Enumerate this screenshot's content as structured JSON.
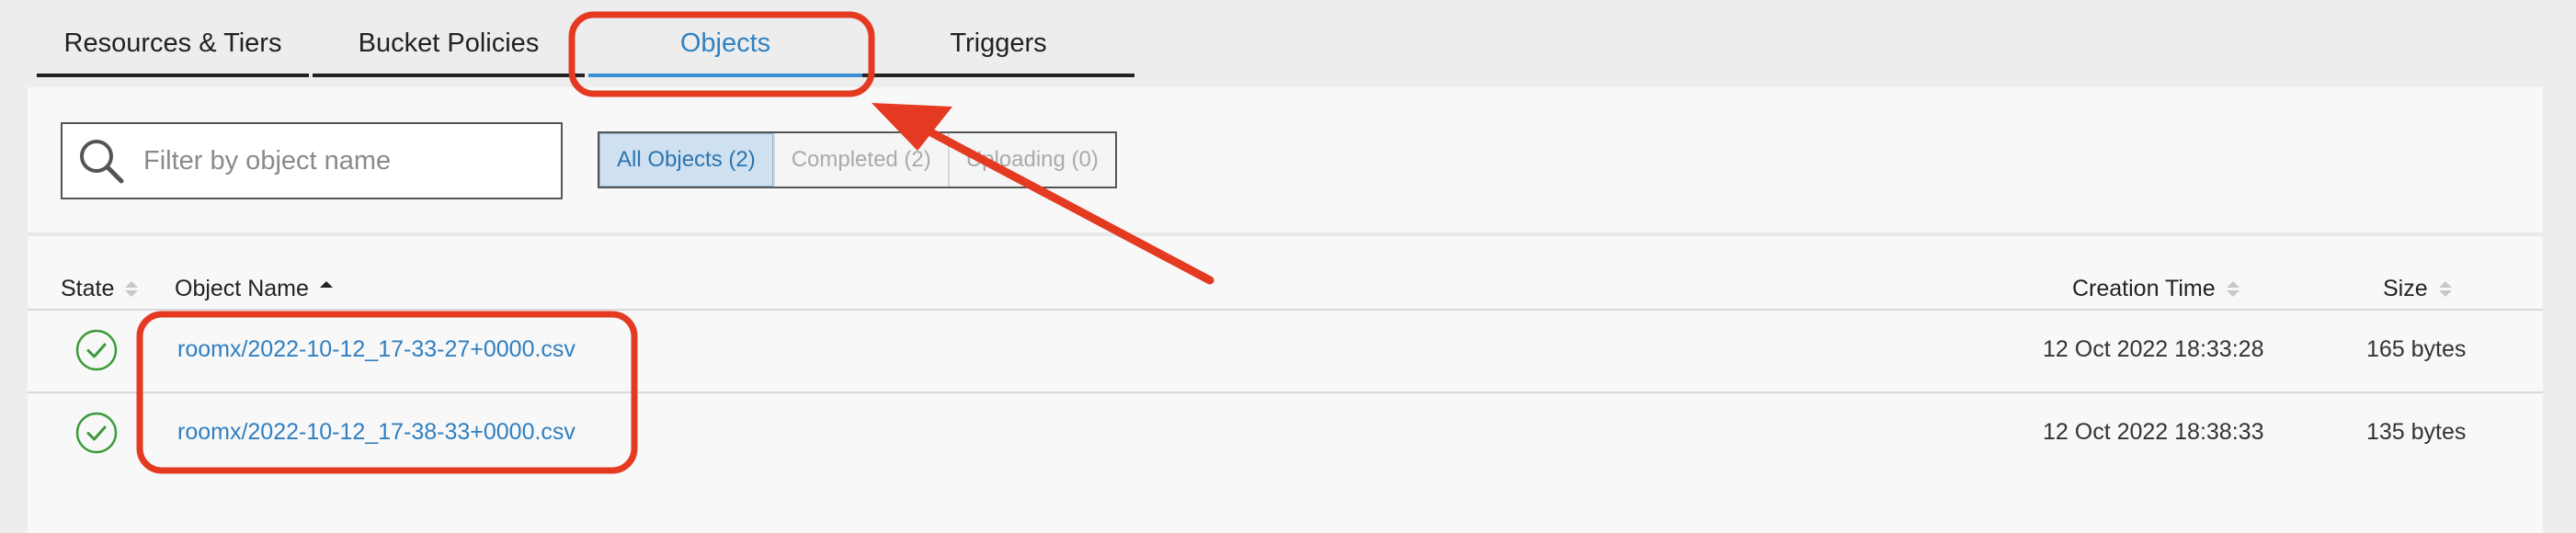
{
  "tabs": [
    {
      "label": "Resources & Tiers",
      "active": false
    },
    {
      "label": "Bucket Policies",
      "active": false
    },
    {
      "label": "Objects",
      "active": true
    },
    {
      "label": "Triggers",
      "active": false
    }
  ],
  "search": {
    "placeholder": "Filter by object name",
    "value": "",
    "icon": "search-icon"
  },
  "filters": [
    {
      "label": "All Objects (2)",
      "active": true
    },
    {
      "label": "Completed (2)",
      "active": false
    },
    {
      "label": "Uploading (0)",
      "active": false
    }
  ],
  "table": {
    "columns": {
      "state": "State",
      "object_name": "Object Name",
      "creation_time": "Creation Time",
      "size": "Size"
    },
    "sort": {
      "column": "object_name",
      "direction": "ascending"
    },
    "rows": [
      {
        "state": "completed",
        "name": "roomx/2022-10-12_17-33-27+0000.csv",
        "creation_time": "12 Oct 2022 18:33:28",
        "size": "165 bytes"
      },
      {
        "state": "completed",
        "name": "roomx/2022-10-12_17-38-33+0000.csv",
        "creation_time": "12 Oct 2022 18:38:33",
        "size": "135 bytes"
      }
    ]
  },
  "colors": {
    "accent": "#2f82c3",
    "success": "#3a9b3a",
    "annotation": "#e53a22"
  }
}
